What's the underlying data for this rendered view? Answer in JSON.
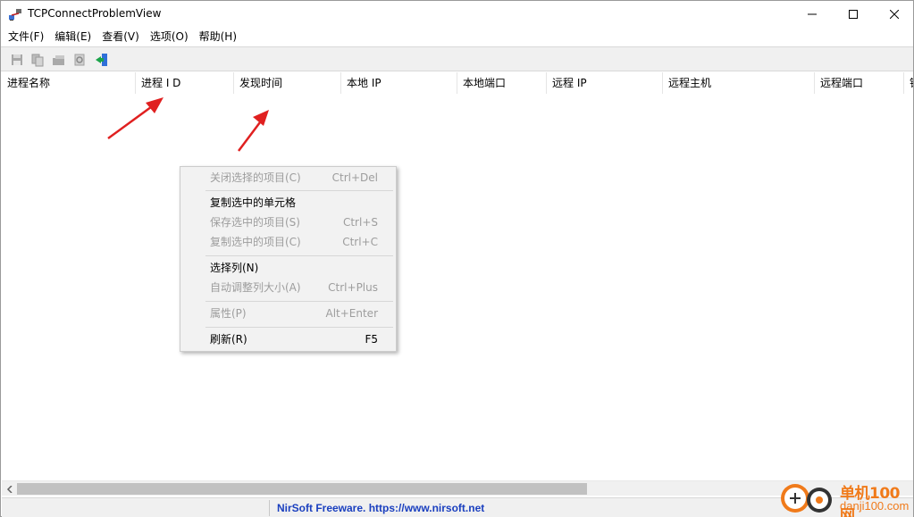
{
  "window": {
    "title": "TCPConnectProblemView"
  },
  "menubar": {
    "items": [
      "文件(F)",
      "编辑(E)",
      "查看(V)",
      "选项(O)",
      "帮助(H)"
    ]
  },
  "toolbar": {
    "buttons": [
      "save-icon",
      "copy-icon",
      "properties-icon",
      "find-icon",
      "exit-icon"
    ]
  },
  "list": {
    "columns": [
      "进程名称",
      "进程 I D",
      "发现时间",
      "本地 IP",
      "本地端口",
      "远程 IP",
      "远程主机",
      "远程端口",
      "错"
    ]
  },
  "context_menu": {
    "items": [
      {
        "label": "关闭选择的项目(C)",
        "shortcut": "Ctrl+Del",
        "enabled": false
      },
      {
        "label": "复制选中的单元格",
        "shortcut": "",
        "enabled": true
      },
      {
        "label": "保存选中的项目(S)",
        "shortcut": "Ctrl+S",
        "enabled": false
      },
      {
        "label": "复制选中的项目(C)",
        "shortcut": "Ctrl+C",
        "enabled": false
      },
      {
        "label": "选择列(N)",
        "shortcut": "",
        "enabled": true
      },
      {
        "label": "自动调整列大小(A)",
        "shortcut": "Ctrl+Plus",
        "enabled": false
      },
      {
        "label": "属性(P)",
        "shortcut": "Alt+Enter",
        "enabled": false
      },
      {
        "label": "刷新(R)",
        "shortcut": "F5",
        "enabled": true
      }
    ]
  },
  "statusbar": {
    "link": "NirSoft Freeware. https://www.nirsoft.net"
  },
  "watermark": {
    "brand": "单机100网",
    "domain": "danji100.com"
  },
  "colors": {
    "arrow": "#e02020",
    "link": "#1a3fbf",
    "watermark": "#f07a1a"
  }
}
